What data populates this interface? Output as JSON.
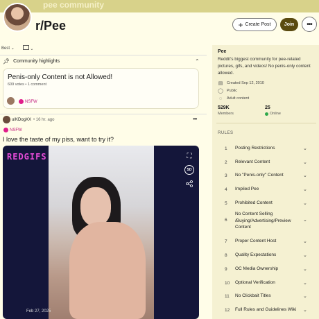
{
  "banner": {
    "text": "pee community"
  },
  "header": {
    "title": "r/Pee",
    "create_post": "Create Post",
    "join": "Join",
    "more": "•••"
  },
  "sort": {
    "label": "Best"
  },
  "highlights": {
    "label": "Community highlights",
    "card": {
      "title": "Penis-only Content is not Allowed!",
      "meta": "609 votes • 1 comment",
      "nsfw": "NSFW"
    }
  },
  "post": {
    "author": "u/KDogXX",
    "time": "• 16 hr. ago",
    "nsfw": "NSFW",
    "title": "I love the taste of my piss, want to try it?",
    "media_logo": "REDGIFS",
    "media_date": "Feb 27, 2025"
  },
  "sidebar": {
    "name": "Pee",
    "description": "Reddit's biggest community for pee-related pictures, gifs, and videos! No penis-only content allowed.",
    "created": "Created Sep 12, 2010",
    "public": "Public",
    "adult": "Adult content",
    "members_count": "529K",
    "members_label": "Members",
    "online_count": "25",
    "online_label": "Online",
    "rules_title": "RULES",
    "rules": [
      {
        "num": "1",
        "text": "Posting Restrictions"
      },
      {
        "num": "2",
        "text": "Relevant Content"
      },
      {
        "num": "3",
        "text": "No \"Penis-only\" Content"
      },
      {
        "num": "4",
        "text": "Implied Pee"
      },
      {
        "num": "5",
        "text": "Prohibited Content"
      },
      {
        "num": "6",
        "text": "No Content Selling /Buying/Advertising/Preview Content"
      },
      {
        "num": "7",
        "text": "Proper Content Host"
      },
      {
        "num": "8",
        "text": "Quality Expectations"
      },
      {
        "num": "9",
        "text": "OC Media Ownership"
      },
      {
        "num": "10",
        "text": "Optional Verification"
      },
      {
        "num": "11",
        "text": "No Clickbait Titles"
      },
      {
        "num": "12",
        "text": "Full Rules and Guidelines Wiki"
      }
    ]
  }
}
